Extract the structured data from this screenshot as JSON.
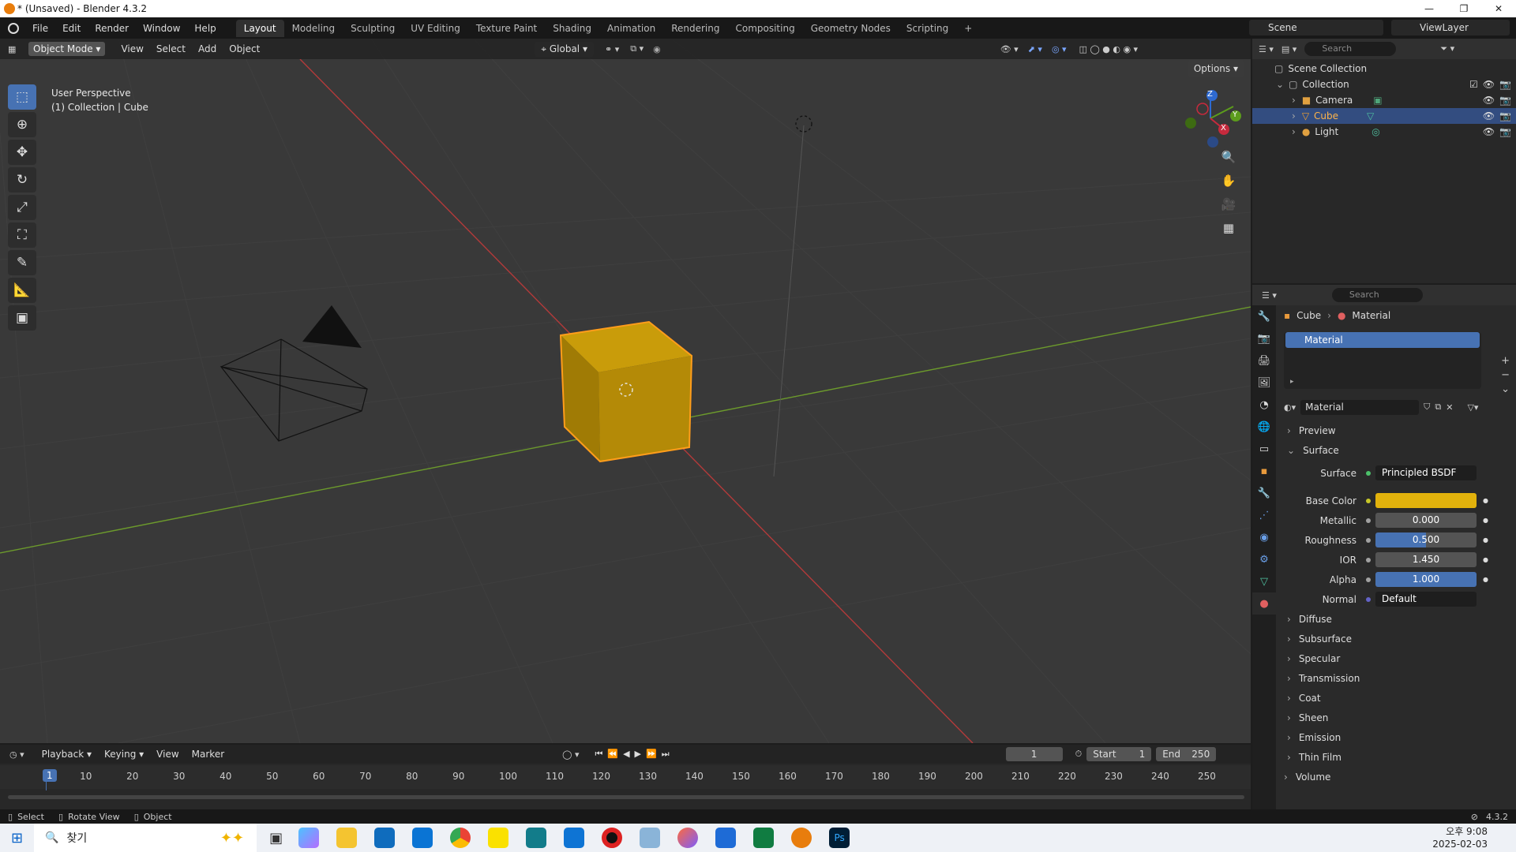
{
  "window": {
    "title": "* (Unsaved) - Blender 4.3.2",
    "min": "—",
    "max": "❐",
    "close": "✕"
  },
  "menu": [
    "File",
    "Edit",
    "Render",
    "Window",
    "Help"
  ],
  "workspaces": [
    "Layout",
    "Modeling",
    "Sculpting",
    "UV Editing",
    "Texture Paint",
    "Shading",
    "Animation",
    "Rendering",
    "Compositing",
    "Geometry Nodes",
    "Scripting",
    "+"
  ],
  "scene": {
    "label": "Scene",
    "viewlayer": "ViewLayer"
  },
  "viewport": {
    "mode": "Object Mode",
    "menus": [
      "View",
      "Select",
      "Add",
      "Object"
    ],
    "orientation": "Global",
    "options": "Options",
    "info_line1": "User Perspective",
    "info_line2": "(1) Collection | Cube",
    "gizmo": {
      "z": "Z",
      "y": "Y",
      "x": "X"
    }
  },
  "outliner": {
    "search_placeholder": "Search",
    "root": "Scene Collection",
    "collection": "Collection",
    "items": [
      {
        "name": "Camera",
        "selected": false
      },
      {
        "name": "Cube",
        "selected": true
      },
      {
        "name": "Light",
        "selected": false
      }
    ]
  },
  "properties": {
    "search_placeholder": "Search",
    "breadcrumb_object": "Cube",
    "breadcrumb_data": "Material",
    "slot": "Material",
    "material_name": "Material",
    "sections_top": [
      "Preview",
      "Surface"
    ],
    "surface_label": "Surface",
    "surface_value": "Principled BSDF",
    "fields": [
      {
        "label": "Base Color",
        "value": "",
        "color": "#e2b20c"
      },
      {
        "label": "Metallic",
        "value": "0.000",
        "fraction": 0
      },
      {
        "label": "Roughness",
        "value": "0.500",
        "fraction": 0.5
      },
      {
        "label": "IOR",
        "value": "1.450",
        "fraction": 0
      },
      {
        "label": "Alpha",
        "value": "1.000",
        "fraction": 1
      },
      {
        "label": "Normal",
        "value": "Default"
      }
    ],
    "subsections": [
      "Diffuse",
      "Subsurface",
      "Specular",
      "Transmission",
      "Coat",
      "Sheen",
      "Emission",
      "Thin Film"
    ],
    "volume": "Volume"
  },
  "timeline": {
    "menus": [
      "Playback",
      "Keying",
      "View",
      "Marker"
    ],
    "current_frame": "1",
    "start_label": "Start",
    "start": "1",
    "end_label": "End",
    "end": "250",
    "ticks": [
      "1",
      "10",
      "20",
      "30",
      "40",
      "50",
      "60",
      "70",
      "80",
      "90",
      "100",
      "110",
      "120",
      "130",
      "140",
      "150",
      "160",
      "170",
      "180",
      "190",
      "200",
      "210",
      "220",
      "230",
      "240",
      "250"
    ]
  },
  "status": {
    "select": "Select",
    "rotate": "Rotate View",
    "object": "Object",
    "version": "4.3.2"
  },
  "taskbar": {
    "search": "찾기",
    "time": "오후 9:08",
    "date": "2025-02-03"
  }
}
